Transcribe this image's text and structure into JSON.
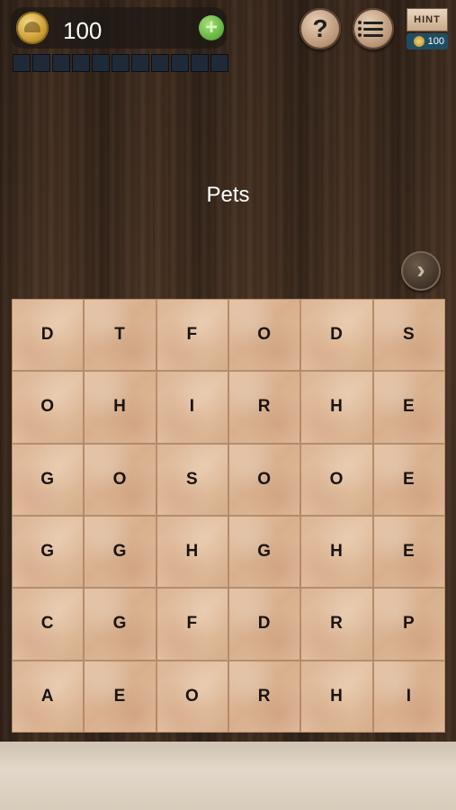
{
  "top_bar": {
    "coins": "100",
    "plus_symbol": "+",
    "progress_slots": 11
  },
  "buttons": {
    "help_symbol": "?",
    "next_symbol": "›"
  },
  "hint": {
    "label": "HINT",
    "cost": "100"
  },
  "category": "Pets",
  "grid": [
    [
      "D",
      "T",
      "F",
      "O",
      "D",
      "S"
    ],
    [
      "O",
      "H",
      "I",
      "R",
      "H",
      "E"
    ],
    [
      "G",
      "O",
      "S",
      "O",
      "O",
      "E"
    ],
    [
      "G",
      "G",
      "H",
      "G",
      "H",
      "E"
    ],
    [
      "C",
      "G",
      "F",
      "D",
      "R",
      "P"
    ],
    [
      "A",
      "E",
      "O",
      "R",
      "H",
      "I"
    ]
  ],
  "colors": {
    "wood": "#3e2c1f",
    "tile": "#dfba98",
    "bottom_panel": "#d8ccbb"
  }
}
